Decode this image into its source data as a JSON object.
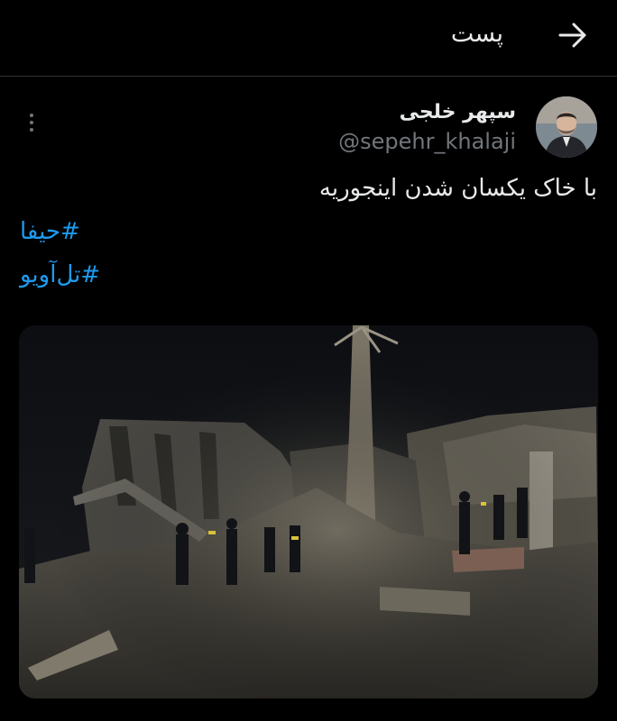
{
  "header": {
    "title": "پست"
  },
  "post": {
    "author": {
      "display_name": "سپهر خلجی",
      "handle": "@sepehr_khalaji"
    },
    "text": "با خاک یکسان شدن اینجوریه",
    "hashtags": [
      "#حیفا",
      "#تل‌آویو"
    ]
  },
  "colors": {
    "background": "#000000",
    "text": "#e7e9ea",
    "muted": "#71767b",
    "link": "#1d9bf0",
    "divider": "#2f3336"
  },
  "icons": {
    "back": "arrow-right-icon",
    "more": "more-vertical-icon"
  }
}
